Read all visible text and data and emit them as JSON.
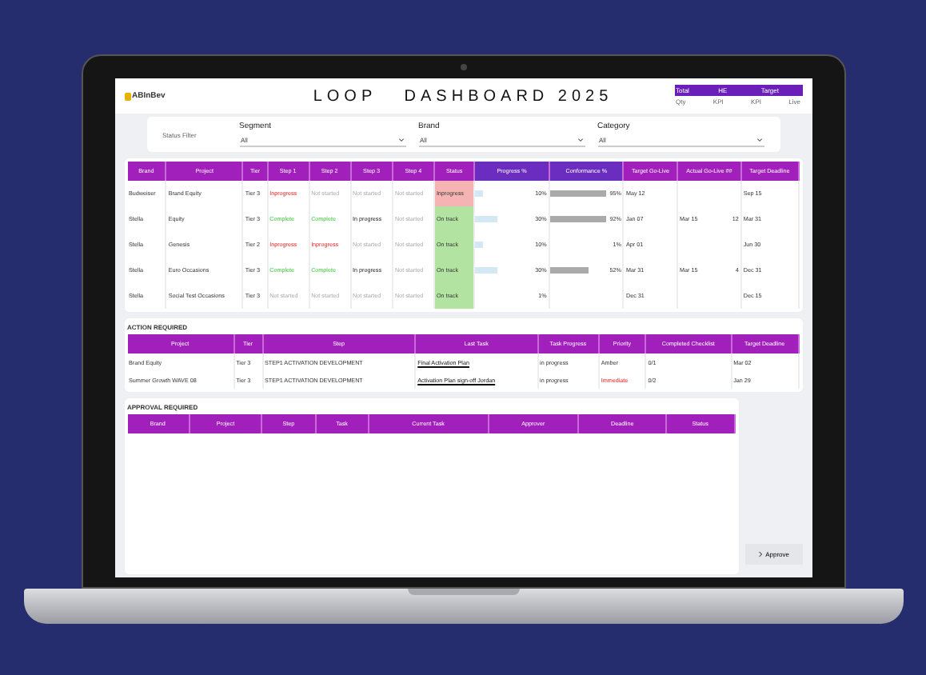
{
  "header": {
    "logo": "ABInBev",
    "title": "LOOP   DASHBOARD 2025",
    "summary": {
      "columns": [
        "Total",
        "HE",
        "Target"
      ],
      "values": [
        "Qty",
        "KPI",
        "KPI",
        "Live"
      ]
    }
  },
  "filters": {
    "label": "Status Filter",
    "fields": [
      {
        "label": "Segment",
        "value": "All"
      },
      {
        "label": "Brand",
        "value": "All"
      },
      {
        "label": "Category",
        "value": "All"
      }
    ]
  },
  "projects": {
    "columns": [
      "Brand",
      "Project",
      "Tier",
      "Step 1",
      "Step 2",
      "Step 3",
      "Step 4",
      "Status",
      "Progress %",
      "Conformance %",
      "Target Go-Live",
      "Actual Go-Live   ##",
      "Target Deadline"
    ],
    "rows": [
      {
        "brand": "Budweiser",
        "project": "Brand Equity",
        "tier": "Tier 3",
        "steps": [
          {
            "text": "Inprogress",
            "kind": "late"
          },
          {
            "text": "Not started",
            "kind": "idle"
          },
          {
            "text": "Not started",
            "kind": "idle"
          },
          {
            "text": "Not started",
            "kind": "idle"
          }
        ],
        "status": {
          "text": "Inprogress",
          "kind": "late"
        },
        "progress": {
          "level": 0.1,
          "text": "10%"
        },
        "conformance": {
          "level": 0.95,
          "text": "95%"
        },
        "target_golive": "May 12",
        "actual": [],
        "deadline": "Sep 15"
      },
      {
        "brand": "Stella",
        "project": "Equity",
        "tier": "Tier 3",
        "steps": [
          {
            "text": "Complete",
            "kind": "done"
          },
          {
            "text": "Complete",
            "kind": "done"
          },
          {
            "text": "In progress",
            "kind": "active"
          },
          {
            "text": "Not started",
            "kind": "idle"
          }
        ],
        "status": {
          "text": "On track",
          "kind": "ok"
        },
        "progress": {
          "level": 0.3,
          "text": "30%"
        },
        "conformance": {
          "level": 0.92,
          "text": "92%"
        },
        "target_golive": "Jan 07",
        "actual": [
          "Mar 15",
          "12"
        ],
        "deadline": "Mar 31"
      },
      {
        "brand": "Stella",
        "project": "Genesis",
        "tier": "Tier 2",
        "steps": [
          {
            "text": "Inprogress",
            "kind": "late"
          },
          {
            "text": "Inprogress",
            "kind": "late"
          },
          {
            "text": "Not started",
            "kind": "idle"
          },
          {
            "text": "Not started",
            "kind": "idle"
          }
        ],
        "status": {
          "text": "On track",
          "kind": "ok"
        },
        "progress": {
          "level": 0.1,
          "text": "10%"
        },
        "conformance": {
          "text": "1%"
        },
        "target_golive": "Apr 01",
        "actual": [],
        "deadline": "Jun 30"
      },
      {
        "brand": "Stella",
        "project": "Euro Occasions",
        "tier": "Tier 3",
        "steps": [
          {
            "text": "Complete",
            "kind": "done"
          },
          {
            "text": "Complete",
            "kind": "done"
          },
          {
            "text": "In progress",
            "kind": "active"
          },
          {
            "text": "Not started",
            "kind": "idle"
          }
        ],
        "status": {
          "text": "On track",
          "kind": "ok"
        },
        "progress": {
          "level": 0.3,
          "text": "30%"
        },
        "conformance": {
          "level": 0.52,
          "text": "52%"
        },
        "target_golive": "Mar 31",
        "actual": [
          "Mar 15",
          "4"
        ],
        "deadline": "Dec 31"
      },
      {
        "brand": "Stella",
        "project": "Social Test Occasions",
        "tier": "Tier 3",
        "steps": [
          {
            "text": "Not started",
            "kind": "idle"
          },
          {
            "text": "Not started",
            "kind": "idle"
          },
          {
            "text": "Not started",
            "kind": "idle"
          },
          {
            "text": "Not started",
            "kind": "idle"
          }
        ],
        "status": {
          "text": "On track",
          "kind": "ok"
        },
        "progress": {
          "text": "1%"
        },
        "conformance": null,
        "target_golive": "Dec 31",
        "actual": [],
        "deadline": "Dec 15"
      }
    ]
  },
  "action_required": {
    "title": "ACTION REQUIRED",
    "columns": [
      "Project",
      "Tier",
      "Step",
      "Last Task",
      "Task Progress",
      "Priority",
      "Completed Checklist",
      "Target Deadline"
    ],
    "rows": [
      {
        "project": "Brand Equity",
        "tier": "Tier 3",
        "step": "STEP1 ACTIVATION DEVELOPMENT",
        "task": "Final Activation Plan",
        "progress": "in progress",
        "priority": {
          "text": "Amber",
          "kind": "normal"
        },
        "checklist": "0/1",
        "deadline": "Mar 02"
      },
      {
        "project": "Summer Growth WAVE 08",
        "tier": "Tier 3",
        "step": "STEP1 ACTIVATION DEVELOPMENT",
        "task": "Activation Plan sign-off Jordan",
        "progress": "in progress",
        "priority": {
          "text": "Immediate",
          "kind": "urgent"
        },
        "checklist": "0/2",
        "deadline": "Jan 29"
      }
    ]
  },
  "approval_required": {
    "title": "APPROVAL REQUIRED",
    "columns": [
      "Brand",
      "Project",
      "Step",
      "Task",
      "Current Task",
      "Approver",
      "Deadline",
      "Status"
    ],
    "button": "Approve"
  }
}
